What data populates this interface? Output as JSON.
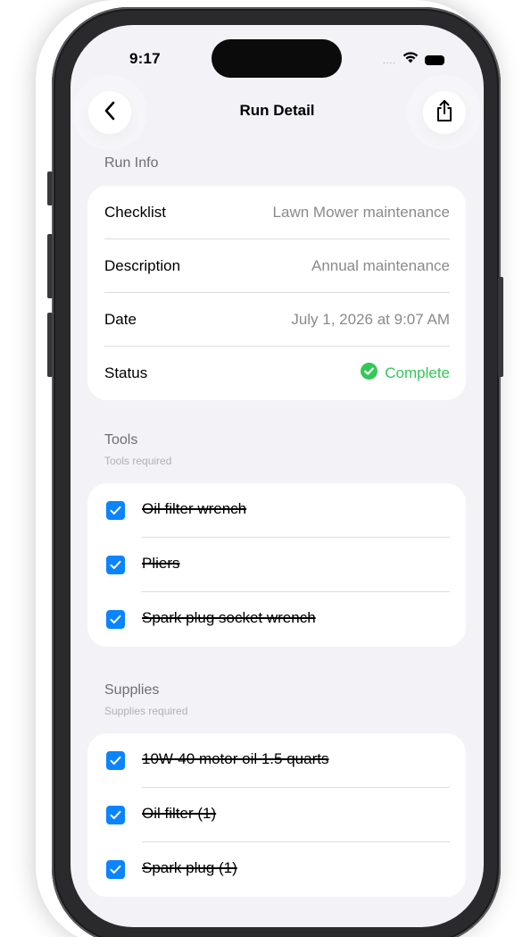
{
  "status_bar": {
    "time": "9:17",
    "signal_dots": "....",
    "wifi_icon": "wifi-icon",
    "battery_icon": "battery-icon"
  },
  "nav": {
    "title": "Run Detail",
    "back_icon": "chevron-left-icon",
    "share_icon": "share-icon"
  },
  "run_info": {
    "header": "Run Info",
    "rows": [
      {
        "label": "Checklist",
        "value": "Lawn Mower maintenance"
      },
      {
        "label": "Description",
        "value": "Annual maintenance"
      },
      {
        "label": "Date",
        "value": "July 1, 2026 at 9:07 AM"
      },
      {
        "label": "Status",
        "value": "Complete"
      }
    ]
  },
  "tools": {
    "header": "Tools",
    "subheader": "Tools required",
    "items": [
      {
        "label": "Oil filter wrench",
        "checked": true
      },
      {
        "label": "Pliers",
        "checked": true
      },
      {
        "label": "Spark plug socket wrench",
        "checked": true
      }
    ]
  },
  "supplies": {
    "header": "Supplies",
    "subheader": "Supplies required",
    "items": [
      {
        "label": "10W-40 motor oil 1.5 quarts",
        "checked": true
      },
      {
        "label": "Oil filter (1)",
        "checked": true
      },
      {
        "label": "Spark plug (1)",
        "checked": true
      }
    ]
  },
  "colors": {
    "accent": "#0a84ff",
    "complete": "#34c759",
    "background": "#f2f2f7"
  }
}
